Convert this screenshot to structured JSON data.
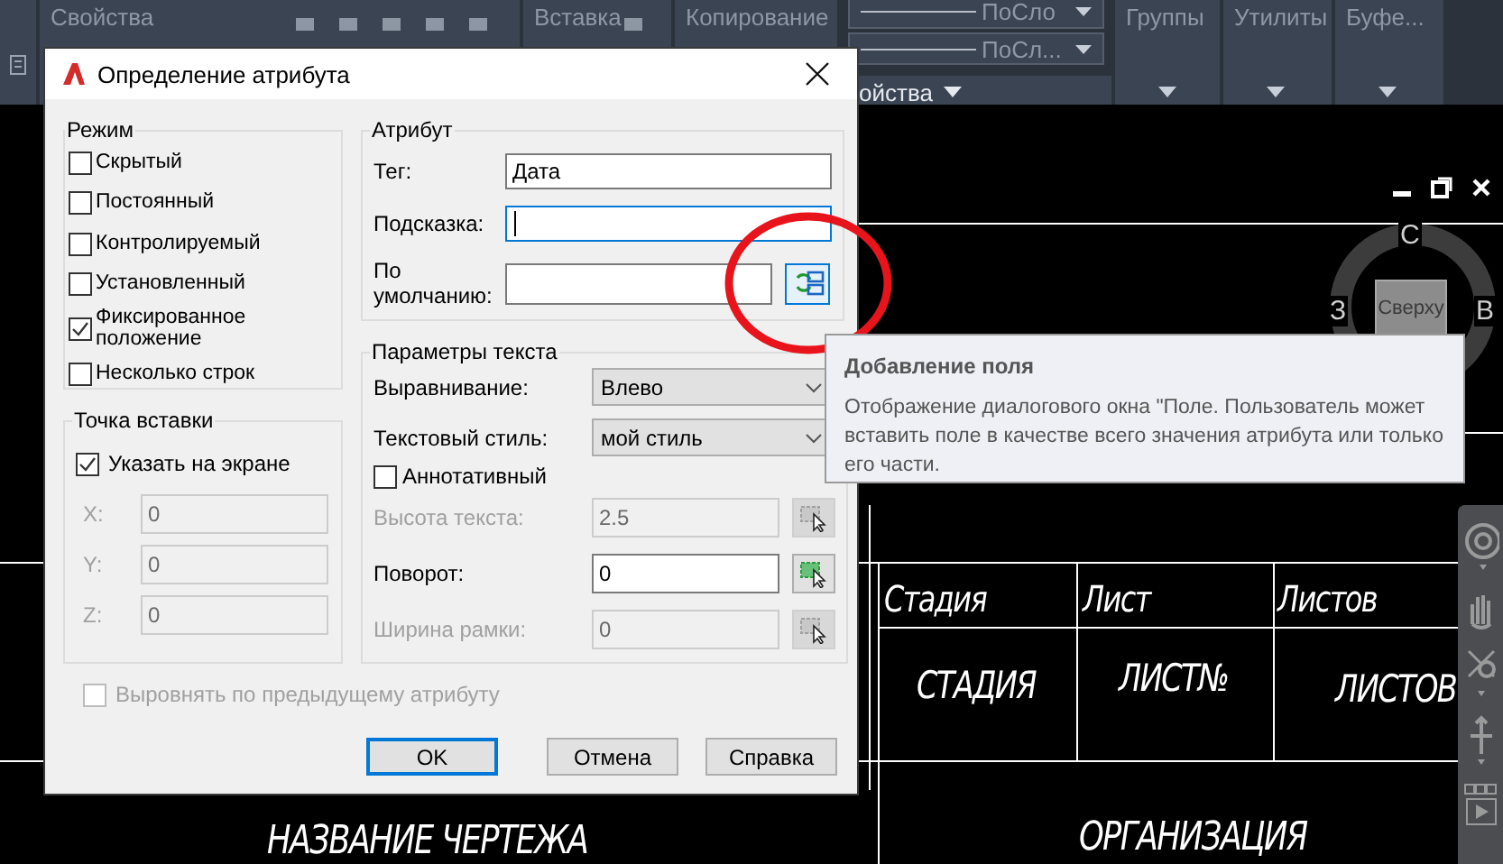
{
  "ribbon": {
    "panels": [
      {
        "kind": "stub"
      },
      {
        "kind": "tools",
        "title": "Свойства"
      },
      {
        "kind": "tools",
        "title": "Вставка"
      },
      {
        "kind": "named",
        "title": "Копирование"
      },
      {
        "kind": "combos",
        "combos": [
          "ПоСло",
          "ПоСл..."
        ],
        "footer": "ойства"
      },
      {
        "kind": "named",
        "title": "Группы"
      },
      {
        "kind": "named",
        "title": "Утилиты"
      },
      {
        "kind": "named",
        "title": "Буфе..."
      }
    ]
  },
  "canvas": {
    "labels": [
      {
        "kind": "header",
        "text": "Стадия"
      },
      {
        "kind": "header",
        "text": "Лист"
      },
      {
        "kind": "header",
        "text": "Листов"
      },
      {
        "kind": "value",
        "text": "СТАДИЯ"
      },
      {
        "kind": "value",
        "text": "ЛИСТ№"
      },
      {
        "kind": "value",
        "text": "ЛИСТОВ"
      },
      {
        "kind": "big",
        "text": "НАЗВАНИЕ ЧЕРТЕЖА"
      },
      {
        "kind": "big",
        "text": "ОРГАНИЗАЦИЯ"
      }
    ]
  },
  "viewcube": {
    "north": "С",
    "west": "З",
    "east": "В",
    "face": "Сверху"
  },
  "dialog": {
    "title": "Определение атрибута",
    "mode": {
      "title": "Режим",
      "options": [
        {
          "label": "Скрытый",
          "checked": false
        },
        {
          "label": "Постоянный",
          "checked": false
        },
        {
          "label": "Контролируемый",
          "checked": false
        },
        {
          "label": "Установленный",
          "checked": false
        },
        {
          "label": "Фиксированное положение",
          "checked": true
        },
        {
          "label": "Несколько строк",
          "checked": false
        }
      ]
    },
    "insertion_point": {
      "title": "Точка вставки",
      "on_screen": {
        "label": "Указать на экране",
        "checked": true
      },
      "coords": [
        {
          "label": "X:",
          "value": "0",
          "disabled": true
        },
        {
          "label": "Y:",
          "value": "0",
          "disabled": true
        },
        {
          "label": "Z:",
          "value": "0",
          "disabled": true
        }
      ]
    },
    "attribute": {
      "title": "Атрибут",
      "fields": [
        {
          "label": "Тег:",
          "value": "Дата",
          "focused": false
        },
        {
          "label": "Подсказка:",
          "focused": true
        },
        {
          "label": "По умолчанию:",
          "focused": false,
          "field_button": true
        }
      ]
    },
    "text_settings": {
      "title": "Параметры текста",
      "rows": [
        {
          "kind": "select",
          "label": "Выравнивание:",
          "value": "Влево"
        },
        {
          "kind": "select",
          "label": "Текстовый стиль:",
          "value": "мой стиль"
        },
        {
          "kind": "checkbox",
          "label": "Аннотативный",
          "checked": false
        },
        {
          "kind": "pick",
          "label": "Высота текста:",
          "value": "2.5",
          "disabled": true
        },
        {
          "kind": "pick",
          "label": "Поворот:",
          "value": "0",
          "disabled": false
        },
        {
          "kind": "pick",
          "label": "Ширина рамки:",
          "value": "0",
          "disabled": true
        }
      ]
    },
    "align_below": {
      "label": "Выровнять по предыдущему атрибуту",
      "checked": false,
      "disabled": true
    },
    "buttons": [
      {
        "label": "OK",
        "default": true
      },
      {
        "label": "Отмена",
        "default": false
      },
      {
        "label": "Справка",
        "default": false
      }
    ]
  },
  "tooltip": {
    "title": "Добавление поля",
    "text": "Отображение диалогового окна \"Поле. Пользователь может вставить поле в качестве всего значения атрибута или только его части."
  }
}
